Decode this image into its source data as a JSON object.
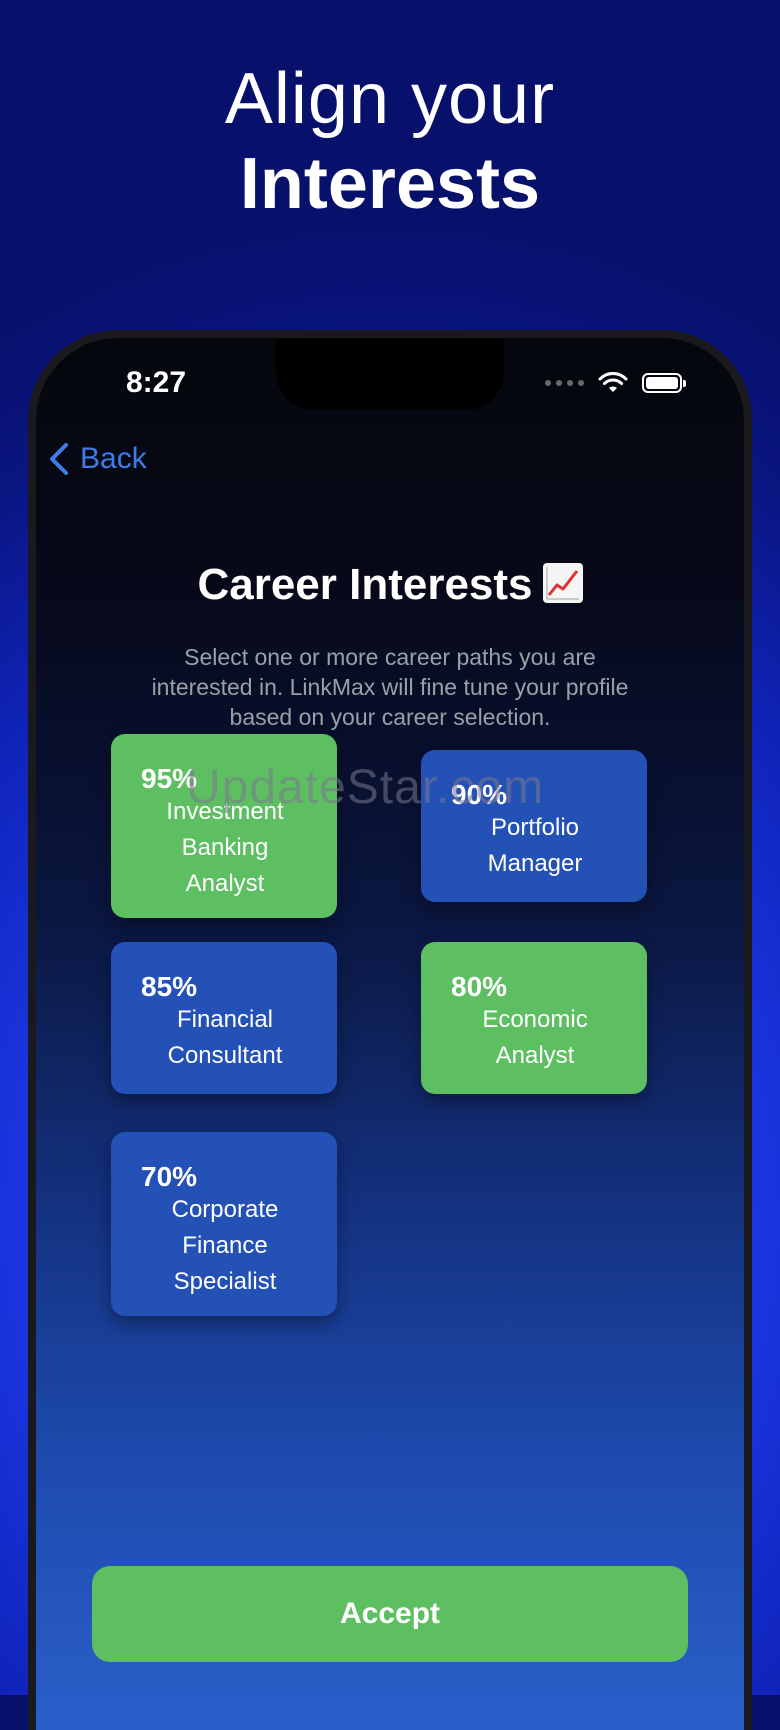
{
  "headline": {
    "line1": "Align your",
    "line2": "Interests"
  },
  "status_bar": {
    "time": "8:27"
  },
  "nav": {
    "back_label": "Back"
  },
  "screen": {
    "title": "Career Interests",
    "title_icon": "chart-increasing-emoji",
    "subtitle": "Select one or more career paths you are interested in. LinkMax will fine tune your profile based on your career selection."
  },
  "watermark": "UpdateStar.com",
  "careers": [
    {
      "percent": "95%",
      "name": "Investment Banking Analyst",
      "selected": true,
      "color": "#5ebf62"
    },
    {
      "percent": "90%",
      "name": "Portfolio Manager",
      "selected": false,
      "color": "#2451b5"
    },
    {
      "percent": "85%",
      "name": "Financial Consultant",
      "selected": false,
      "color": "#2451b5"
    },
    {
      "percent": "80%",
      "name": "Economic Analyst",
      "selected": true,
      "color": "#5ebf62"
    },
    {
      "percent": "70%",
      "name": "Corporate Finance Specialist",
      "selected": false,
      "color": "#2451b5"
    }
  ],
  "actions": {
    "accept_label": "Accept"
  },
  "colors": {
    "accent_blue": "#3d7dea",
    "selected_green": "#5ebf62",
    "card_blue": "#2451b5"
  }
}
